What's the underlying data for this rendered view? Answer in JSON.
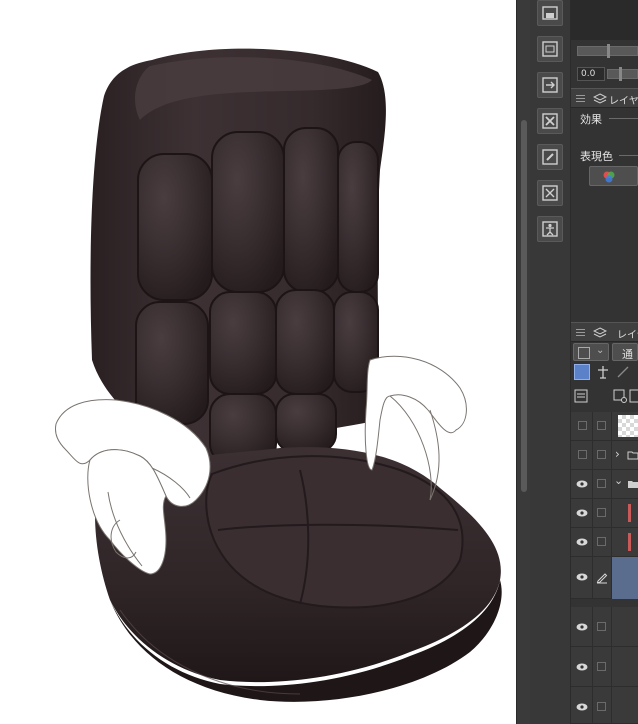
{
  "canvas": {
    "subject": "office-chair-drawing",
    "line_color": "#7a7470",
    "armrest_fill": "#ffffff",
    "upholstery_color": "#3b2f31"
  },
  "command_bar": {
    "buttons": [
      {
        "name": "save-layer-icon"
      },
      {
        "name": "layer-property-icon"
      },
      {
        "name": "convert-layer-icon"
      },
      {
        "name": "clear-layer-icon"
      },
      {
        "name": "edit-layer-icon"
      },
      {
        "name": "delete-layer-icon"
      },
      {
        "name": "figure-pose-icon"
      }
    ]
  },
  "panel": {
    "opacity_value": "0.0",
    "layer_property_tab": "レイヤ",
    "effect_label": "効果",
    "expression_color_label": "表現色",
    "layer_tab": "レイヤ",
    "blend_mode": "通"
  },
  "layers": [
    {
      "visible": false,
      "type": "image"
    },
    {
      "visible": false,
      "type": "folder-collapsed"
    },
    {
      "visible": true,
      "type": "folder-expanded"
    },
    {
      "visible": true,
      "type": "raster-red"
    },
    {
      "visible": true,
      "type": "raster-red"
    },
    {
      "visible": true,
      "type": "raster-selected",
      "editing": true
    },
    {
      "visible": true,
      "type": "raster"
    },
    {
      "visible": true,
      "type": "raster"
    },
    {
      "visible": true,
      "type": "raster"
    }
  ],
  "colors": {
    "panel_bg": "#333333",
    "selected_layer": "#5b6d8f",
    "accent_red": "#c85a5a"
  }
}
